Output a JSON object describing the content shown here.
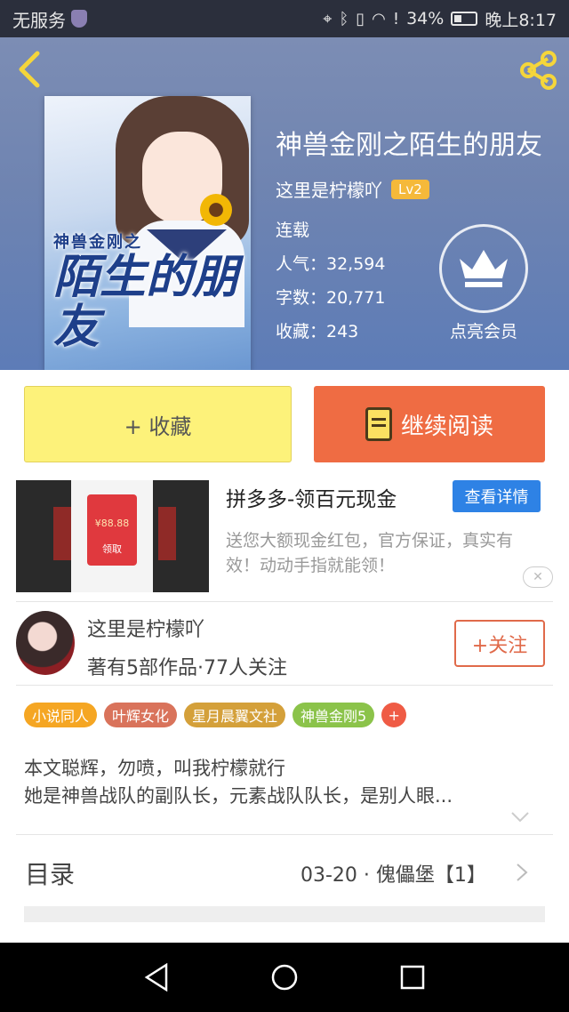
{
  "status_bar": {
    "carrier": "无服务",
    "battery": "34%",
    "time": "晚上8:17"
  },
  "book": {
    "title": "神兽金刚之陌生的朋友",
    "author": "这里是柠檬吖",
    "author_level": "Lv2",
    "status": "连载",
    "popularity": "人气：32,594",
    "word_count": "字数：20,771",
    "favorites": "收藏：243",
    "cover_small_text": "神兽金刚之",
    "cover_big_text": "陌生的朋友"
  },
  "vip": {
    "label": "点亮会员"
  },
  "actions": {
    "collect_label": "+ 收藏",
    "read_label": "继续阅读"
  },
  "ad": {
    "title": "拼多多-领百元现金",
    "detail_label": "查看详情",
    "description": "送您大额现金红包，官方保证，真实有效！动动手指就能领！",
    "amount": "¥88.88",
    "claim": "领取"
  },
  "author_card": {
    "name": "这里是柠檬吖",
    "meta": "著有5部作品·77人关注",
    "follow_label": "+关注"
  },
  "tags": [
    {
      "label": "小说同人",
      "color": "#f5a623"
    },
    {
      "label": "叶辉女化",
      "color": "#d9735b"
    },
    {
      "label": "星月晨翼文社",
      "color": "#d4a03a"
    },
    {
      "label": "神兽金刚5",
      "color": "#8bc34a"
    }
  ],
  "tag_add": "+",
  "description": {
    "line1": "本文聪辉，勿喷，叫我柠檬就行",
    "line2": "她是神兽战队的副队长，元素战队队长，是别人眼..."
  },
  "toc": {
    "label": "目录",
    "latest": "03-20 · 傀儡堡【1】"
  },
  "colors": {
    "header": "#6f84b1",
    "collect_bg": "#fdf27a",
    "read_bg": "#ef6c43",
    "follow": "#e06a4a",
    "detail_btn": "#2e82e5"
  }
}
